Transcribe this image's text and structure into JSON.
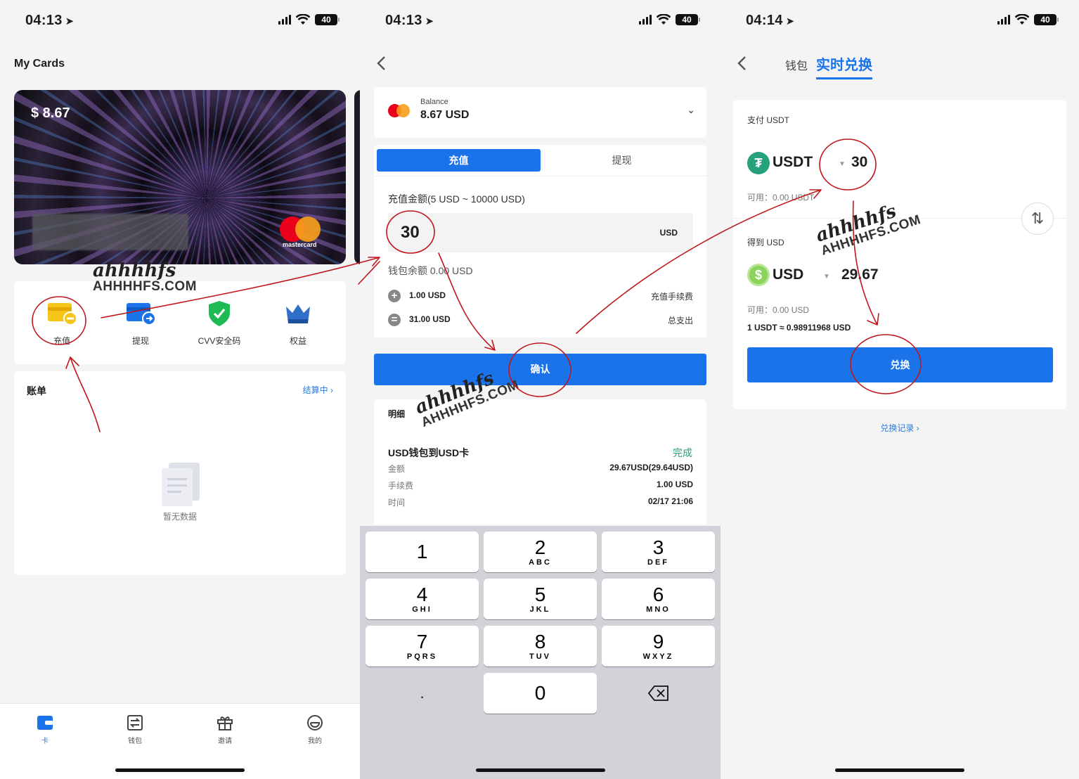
{
  "status": {
    "time1": "04:13",
    "time2": "04:13",
    "time3": "04:14",
    "battery": "40"
  },
  "panel1": {
    "title": "My Cards",
    "card_balance": "$ 8.67",
    "card_brand": "mastercard",
    "actions": [
      "充值",
      "提现",
      "CVV安全码",
      "权益"
    ],
    "bill_title": "账单",
    "bill_more": "结算中",
    "empty_text": "暂无数据",
    "tabs": [
      "卡",
      "钱包",
      "邀请",
      "我的"
    ]
  },
  "panel2": {
    "balance_label": "Balance",
    "balance_value": "8.67 USD",
    "seg_active": "充值",
    "seg_inactive": "提现",
    "range_label": "充值金额(5 USD ~ 10000 USD)",
    "amount": "30",
    "amount_unit": "USD",
    "wallet_balance": "钱包余额 0.00 USD",
    "fee_value": "1.00 USD",
    "fee_label": "充值手续费",
    "total_value": "31.00 USD",
    "total_label": "总支出",
    "confirm": "确认",
    "detail_title": "明细",
    "detail_name": "USD钱包到USD卡",
    "detail_status": "完成",
    "rows": [
      {
        "k": "金额",
        "v": "29.67USD(29.64USD)"
      },
      {
        "k": "手续费",
        "v": "1.00 USD"
      },
      {
        "k": "时间",
        "v": "02/17 21:06"
      }
    ],
    "keys": [
      {
        "d": "1",
        "l": ""
      },
      {
        "d": "2",
        "l": "ABC"
      },
      {
        "d": "3",
        "l": "DEF"
      },
      {
        "d": "4",
        "l": "GHI"
      },
      {
        "d": "5",
        "l": "JKL"
      },
      {
        "d": "6",
        "l": "MNO"
      },
      {
        "d": "7",
        "l": "PQRS"
      },
      {
        "d": "8",
        "l": "TUV"
      },
      {
        "d": "9",
        "l": "WXYZ"
      },
      {
        "d": "0",
        "l": ""
      }
    ],
    "key_dot": "."
  },
  "panel3": {
    "tab_wallet": "钱包",
    "tab_exchange": "实时兑换",
    "pay_label": "支付 USDT",
    "pay_coin": "USDT",
    "pay_amount": "30",
    "pay_avail": "可用：0.00 USDT",
    "get_label": "得到 USD",
    "get_coin": "USD",
    "get_amount": "29.67",
    "get_avail": "可用：0.00 USD",
    "rate": "1 USDT ≈ 0.98911968 USD",
    "exchange": "兑换",
    "history": "兑换记录"
  },
  "watermark": {
    "script": "ahhhhfs",
    "domain": "AHHHHFS.COM"
  },
  "colors": {
    "accent": "#1a73e8",
    "annotation": "#c0161c",
    "success": "#23a26d"
  }
}
